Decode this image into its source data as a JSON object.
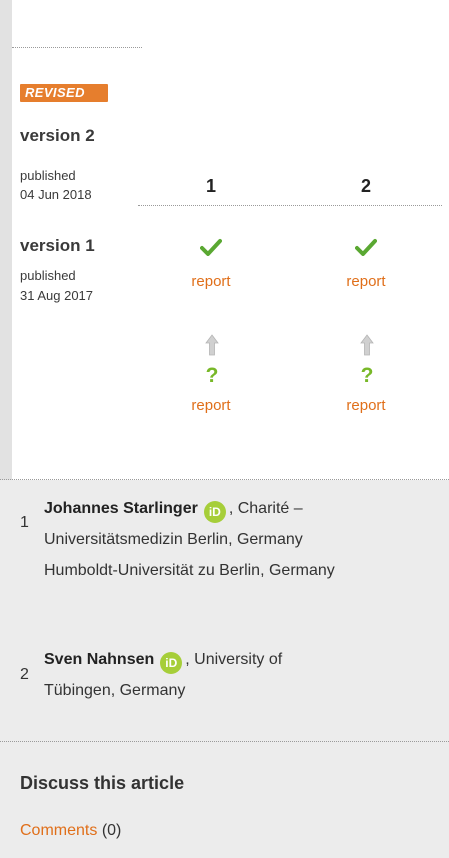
{
  "badge": {
    "text": "REVISED"
  },
  "versions": [
    {
      "title": "version 2",
      "published_label": "published",
      "date": "04 Jun 2018"
    },
    {
      "title": "version 1",
      "published_label": "published",
      "date": "31 Aug 2017"
    }
  ],
  "reviewer_columns": [
    "1",
    "2"
  ],
  "reports": {
    "v2": [
      {
        "status": "approved",
        "icon": "check-icon",
        "label": "report"
      },
      {
        "status": "approved",
        "icon": "check-icon",
        "label": "report"
      }
    ],
    "v1": [
      {
        "status": "approved-with-reservations",
        "icon": "question-mark-icon",
        "label": "report",
        "symbol": "?"
      },
      {
        "status": "approved-with-reservations",
        "icon": "question-mark-icon",
        "label": "report",
        "symbol": "?"
      }
    ]
  },
  "reviewers": [
    {
      "number": "1",
      "name": "Johannes Starlinger",
      "orcid_label": "iD",
      "affiliation_line1": ", Charité –",
      "affiliation_line2": "Universitätsmedizin Berlin, Germany",
      "affiliation_line3": "Humboldt-Universität zu Berlin, Germany"
    },
    {
      "number": "2",
      "name": "Sven Nahnsen",
      "orcid_label": "iD",
      "affiliation_line1": ", University of",
      "affiliation_line2": "Tübingen, Germany"
    }
  ],
  "discussion": {
    "title": "Discuss this article",
    "comments_link": "Comments",
    "comments_count": "(0)"
  },
  "colors": {
    "accent_orange": "#e06f1a",
    "badge_orange": "#e67e2d",
    "approved_green": "#5aa832",
    "orcid_green": "#a6ce39"
  }
}
